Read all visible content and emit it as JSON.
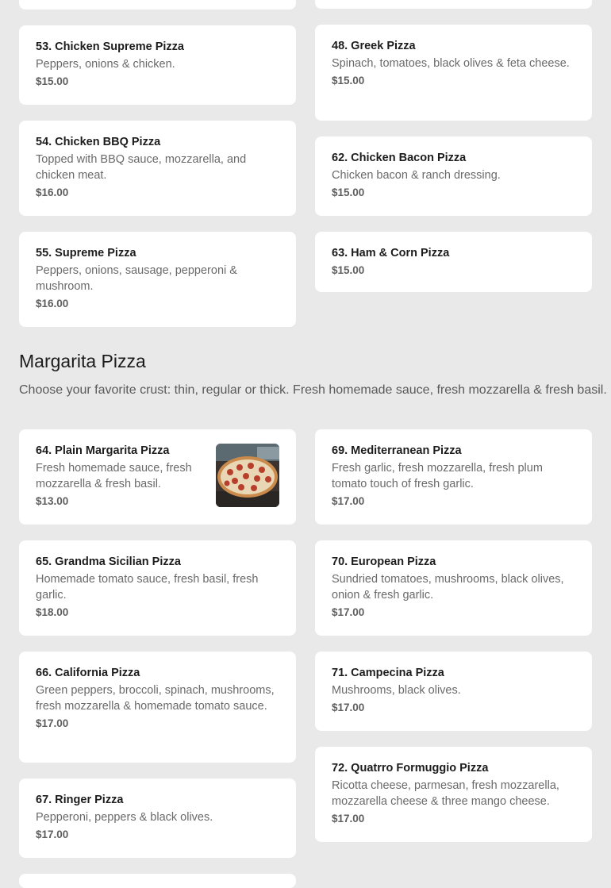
{
  "section": {
    "title": "Margarita Pizza",
    "description": "Choose your favorite crust: thin, regular or thick. Fresh homemade sauce, fresh mozzarella & fresh basil."
  },
  "items": {
    "i53": {
      "name": "53. Chicken Supreme Pizza",
      "desc": "Peppers, onions & chicken.",
      "price": "$15.00"
    },
    "i48": {
      "name": "48. Greek Pizza",
      "desc": "Spinach, tomatoes, black olives & feta cheese.",
      "price": "$15.00"
    },
    "i54": {
      "name": "54. Chicken BBQ Pizza",
      "desc": "Topped with BBQ sauce, mozzarella, and chicken meat.",
      "price": "$16.00"
    },
    "i62": {
      "name": "62. Chicken Bacon Pizza",
      "desc": "Chicken bacon & ranch dressing.",
      "price": "$15.00"
    },
    "i55": {
      "name": "55. Supreme Pizza",
      "desc": "Peppers, onions, sausage, pepperoni & mushroom.",
      "price": "$16.00"
    },
    "i63": {
      "name": "63. Ham & Corn Pizza",
      "price": "$15.00"
    },
    "i64": {
      "name": "64. Plain Margarita Pizza",
      "desc": "Fresh homemade sauce, fresh mozzarella & fresh basil.",
      "price": "$13.00",
      "image_icon": "pizza-photo"
    },
    "i69": {
      "name": "69. Mediterranean Pizza",
      "desc": "Fresh garlic, fresh mozzarella, fresh plum tomato touch of fresh garlic.",
      "price": "$17.00"
    },
    "i65": {
      "name": "65. Grandma Sicilian Pizza",
      "desc": "Homemade tomato sauce, fresh basil, fresh garlic.",
      "price": "$18.00"
    },
    "i70": {
      "name": "70. European Pizza",
      "desc": "Sundried tomatoes, mushrooms, black olives, onion & fresh garlic.",
      "price": "$17.00"
    },
    "i66": {
      "name": "66. California Pizza",
      "desc": "Green peppers, broccoli, spinach, mushrooms, fresh mozzarella & homemade tomato sauce.",
      "price": "$17.00"
    },
    "i71": {
      "name": "71. Campecina Pizza",
      "desc": "Mushrooms, black olives.",
      "price": "$17.00"
    },
    "i67": {
      "name": "67. Ringer Pizza",
      "desc": "Pepperoni, peppers & black olives.",
      "price": "$17.00"
    },
    "i72": {
      "name": "72. Quatrro Formuggio Pizza",
      "desc": "Ricotta cheese, parmesan, fresh mozzarella, mozzarella cheese & three mango cheese.",
      "price": "$17.00"
    }
  },
  "colors": {
    "background": "#e9e9e9",
    "card": "#ffffff",
    "title_text": "#1c1c1c",
    "muted_text": "#6a6a6a"
  }
}
